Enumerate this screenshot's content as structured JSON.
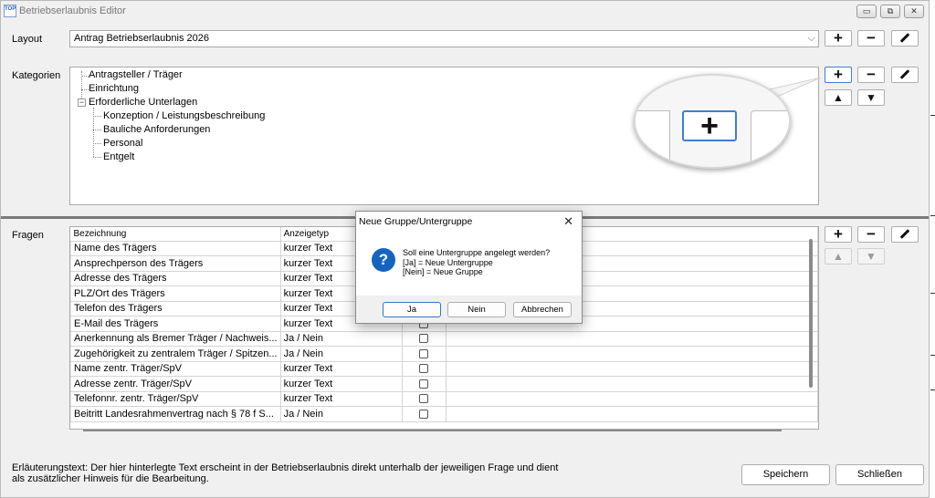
{
  "window": {
    "title": "Betriebserlaubnis Editor",
    "app_icon_text": "TOP",
    "buttons": {
      "minimize": "▭",
      "maximize": "⧉",
      "close": "✕"
    }
  },
  "layout": {
    "label": "Layout",
    "selected": "Antrag Betriebserlaubnis 2026"
  },
  "categories": {
    "label": "Kategorien",
    "items": [
      "Antragsteller / Träger",
      "Einrichtung",
      "Erforderliche Unterlagen",
      "Konzeption / Leistungsbeschreibung",
      "Bauliche Anforderungen",
      "Personal",
      "Entgelt"
    ],
    "expander_symbol": "−"
  },
  "toolbar": {
    "add": "+",
    "remove": "−",
    "up": "▲",
    "down": "▼"
  },
  "magnifier": {
    "button": "+"
  },
  "fragen": {
    "label": "Fragen",
    "columns": [
      "Bezeichnung",
      "Anzeigetyp",
      "",
      ""
    ],
    "rows": [
      {
        "bezeichnung": "Name des Trägers",
        "typ": "kurzer Text"
      },
      {
        "bezeichnung": "Ansprechperson des Trägers",
        "typ": "kurzer Text"
      },
      {
        "bezeichnung": "Adresse des Trägers",
        "typ": "kurzer Text"
      },
      {
        "bezeichnung": "PLZ/Ort des Trägers",
        "typ": "kurzer Text"
      },
      {
        "bezeichnung": "Telefon des Trägers",
        "typ": "kurzer Text"
      },
      {
        "bezeichnung": "E-Mail des Trägers",
        "typ": "kurzer Text"
      },
      {
        "bezeichnung": "Anerkennung als Bremer Träger / Nachweis...",
        "typ": "Ja / Nein"
      },
      {
        "bezeichnung": "Zugehörigkeit zu zentralem Träger / Spitzen...",
        "typ": "Ja / Nein"
      },
      {
        "bezeichnung": "Name zentr. Träger/SpV",
        "typ": "kurzer Text"
      },
      {
        "bezeichnung": "Adresse zentr. Träger/SpV",
        "typ": "kurzer Text"
      },
      {
        "bezeichnung": "Telefonnr. zentr. Träger/SpV",
        "typ": "kurzer Text"
      },
      {
        "bezeichnung": "Beitritt Landesrahmenvertrag nach § 78 f S...",
        "typ": "Ja / Nein"
      }
    ]
  },
  "hint": {
    "line1": "Erläuterungstext: Der hier hinterlegte Text erscheint in der Betriebserlaubnis direkt unterhalb der jeweiligen Frage und dient",
    "line2": "als zusätzlicher Hinweis für die Bearbeitung."
  },
  "footer": {
    "save": "Speichern",
    "close": "Schließen"
  },
  "dialog": {
    "title": "Neue Gruppe/Untergruppe",
    "close": "✕",
    "icon": "?",
    "line1": "Soll eine Untergruppe angelegt werden?",
    "line2": "[Ja] = Neue Untergruppe",
    "line3": "[Nein] = Neue Gruppe",
    "yes": "Ja",
    "no": "Nein",
    "cancel": "Abbrechen"
  }
}
